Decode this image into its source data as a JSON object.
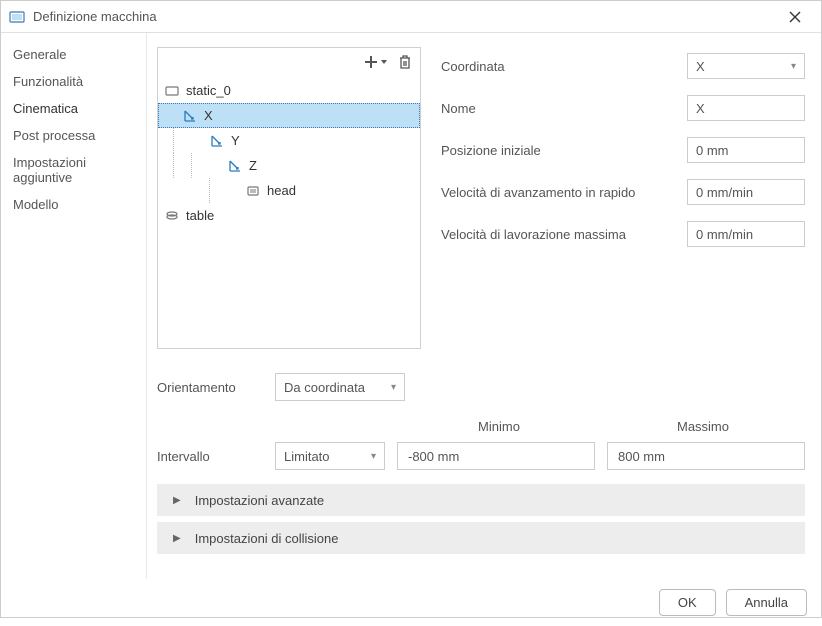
{
  "window": {
    "title": "Definizione macchina"
  },
  "sidebar": {
    "items": [
      {
        "label": "Generale"
      },
      {
        "label": "Funzionalità"
      },
      {
        "label": "Cinematica"
      },
      {
        "label": "Post processa"
      },
      {
        "label": "Impostazioni aggiuntive"
      },
      {
        "label": "Modello"
      }
    ]
  },
  "tree": {
    "items": [
      {
        "label": "static_0"
      },
      {
        "label": "X"
      },
      {
        "label": "Y"
      },
      {
        "label": "Z"
      },
      {
        "label": "head"
      },
      {
        "label": "table"
      }
    ]
  },
  "fields": {
    "coord_label": "Coordinata",
    "coord_value": "X",
    "name_label": "Nome",
    "name_value": "X",
    "initpos_label": "Posizione iniziale",
    "initpos_value": "0 mm",
    "rapid_label": "Velocità di avanzamento in rapido",
    "rapid_value": "0 mm/min",
    "maxfeed_label": "Velocità di lavorazione massima",
    "maxfeed_value": "0 mm/min"
  },
  "orient": {
    "label": "Orientamento",
    "value": "Da coordinata"
  },
  "range": {
    "label": "Intervallo",
    "min_header": "Minimo",
    "max_header": "Massimo",
    "mode": "Limitato",
    "min_value": "-800 mm",
    "max_value": "800 mm"
  },
  "expanders": {
    "advanced": "Impostazioni avanzate",
    "collision": "Impostazioni di collisione"
  },
  "buttons": {
    "ok": "OK",
    "cancel": "Annulla"
  }
}
